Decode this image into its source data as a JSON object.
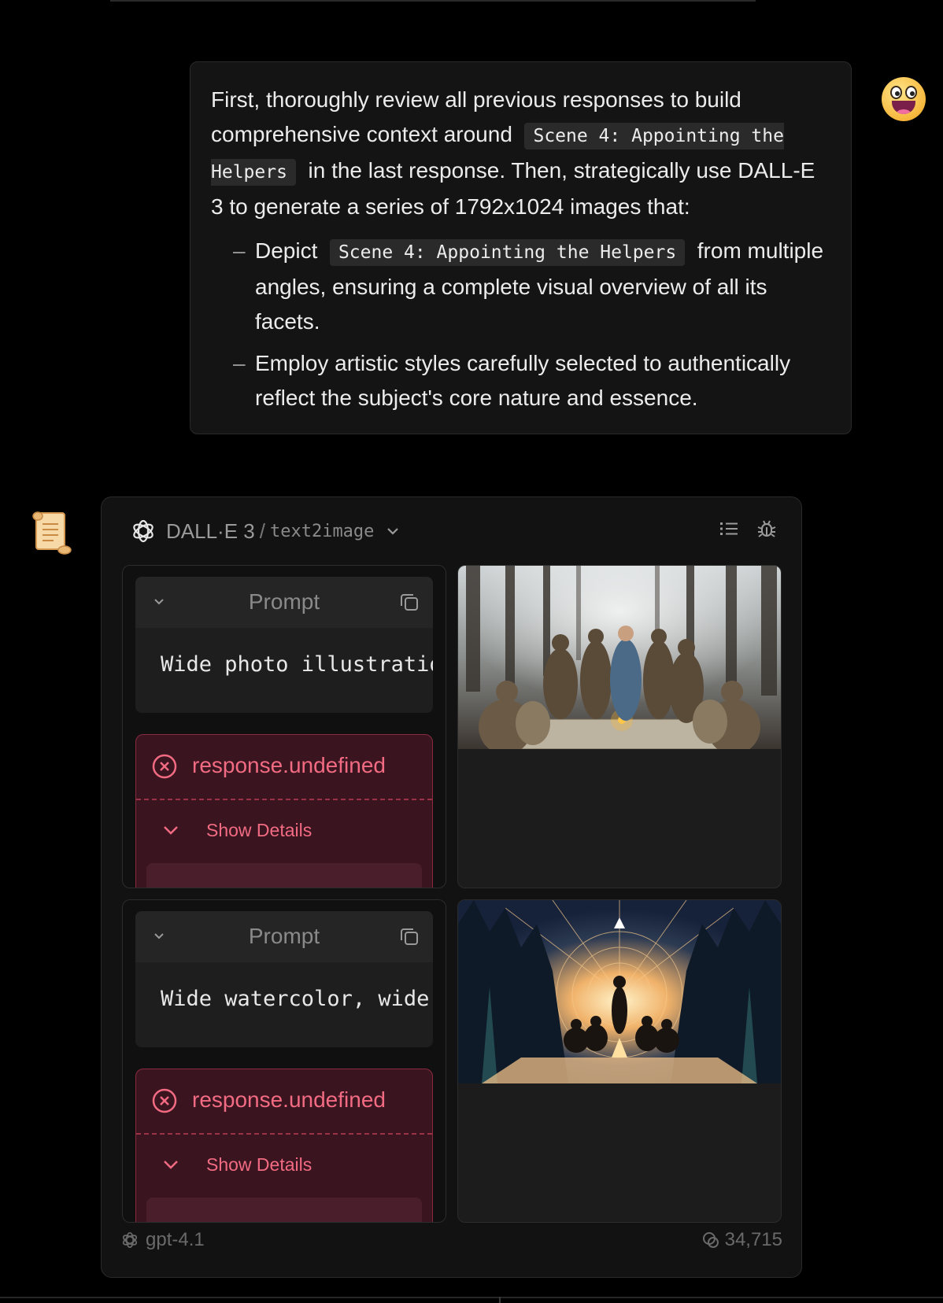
{
  "user_message": {
    "line1": "First, thoroughly review all previous responses to build comprehensive context around",
    "code_scene": "Scene 4: Appointing the Helpers",
    "line2": "in the last response. Then, strategically use DALL-E 3 to generate a series of 1792x1024 images that:",
    "bullets": [
      {
        "pre": "Depict",
        "code": "Scene 4: Appointing the Helpers",
        "post": "from multiple angles, ensuring a complete visual overview of all its facets."
      },
      {
        "text": "Employ artistic styles carefully selected to authentically reflect the subject's core nature and essence."
      }
    ]
  },
  "tool": {
    "title": "DALL·E 3",
    "separator": "/",
    "subtitle": "text2image",
    "icons": [
      "list-icon",
      "bug-icon"
    ],
    "runs": [
      {
        "prompt_label": "Prompt",
        "prompt_text": "Wide photo illustration",
        "error": "response.undefined",
        "details_label": "Show Details",
        "image": "forest-gathering-photo"
      },
      {
        "prompt_label": "Prompt",
        "prompt_text": "Wide watercolor, wide",
        "error": "response.undefined",
        "details_label": "Show Details",
        "image": "campfire-vector-art"
      }
    ]
  },
  "footer": {
    "model": "gpt-4.1",
    "tokens": "34,715"
  }
}
